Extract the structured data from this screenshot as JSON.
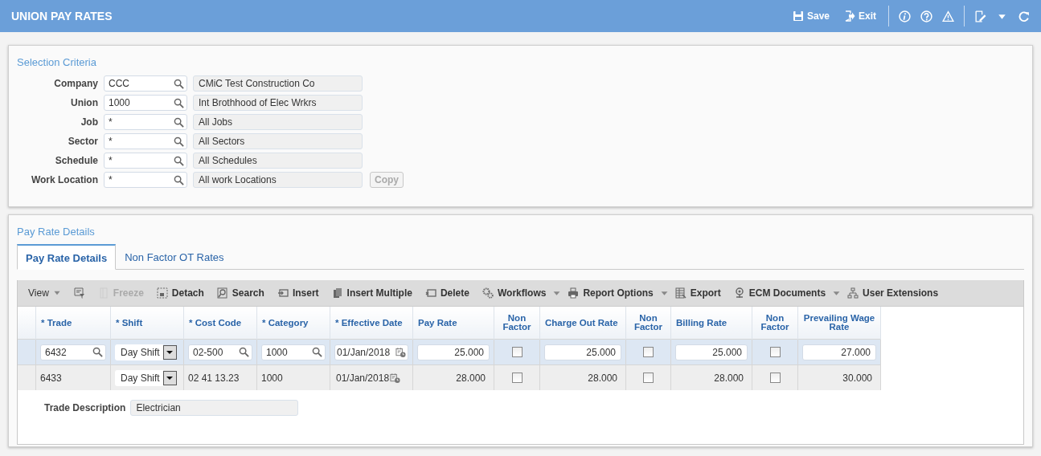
{
  "header": {
    "title": "UNION PAY RATES",
    "actions": [
      {
        "label": "Save"
      },
      {
        "label": "Exit"
      }
    ]
  },
  "selection": {
    "title": "Selection Criteria",
    "fields": [
      {
        "label": "Company",
        "value": "CCC",
        "description": "CMiC Test Construction Co"
      },
      {
        "label": "Union",
        "value": "1000",
        "description": "Int Brothhood of Elec Wrkrs"
      },
      {
        "label": "Job",
        "value": "*",
        "description": "All Jobs"
      },
      {
        "label": "Sector",
        "value": "*",
        "description": "All Sectors"
      },
      {
        "label": "Schedule",
        "value": "*",
        "description": "All Schedules"
      },
      {
        "label": "Work Location",
        "value": "*",
        "description": "All work Locations"
      }
    ],
    "copy_button": {
      "label": "Copy",
      "disabled": true
    }
  },
  "details": {
    "title": "Pay Rate Details",
    "tabs": [
      {
        "label": "Pay Rate Details",
        "selected": true
      },
      {
        "label": "Non Factor OT Rates",
        "selected": false
      }
    ],
    "toolbar": [
      {
        "label": "View",
        "disabled": false,
        "dropdown": true
      },
      {
        "disabled": false,
        "dropdown": false
      },
      {
        "label": "Freeze",
        "disabled": true,
        "dropdown": false
      },
      {
        "label": "Detach",
        "disabled": false,
        "dropdown": false
      },
      {
        "label": "Search",
        "disabled": false,
        "dropdown": false
      },
      {
        "label": "Insert",
        "disabled": false,
        "dropdown": false
      },
      {
        "label": "Insert Multiple",
        "disabled": false,
        "dropdown": false
      },
      {
        "label": "Delete",
        "disabled": false,
        "dropdown": false
      },
      {
        "label": "Workflows",
        "disabled": false,
        "dropdown": true
      },
      {
        "label": "Report Options",
        "disabled": false,
        "dropdown": true
      },
      {
        "label": "Export",
        "disabled": false,
        "dropdown": false
      },
      {
        "label": "ECM Documents",
        "disabled": false,
        "dropdown": true
      },
      {
        "label": "User Extensions",
        "disabled": false,
        "dropdown": false
      }
    ],
    "columns": [
      "* Trade",
      "* Shift",
      "* Cost Code",
      "* Category",
      "* Effective Date",
      "Pay Rate",
      "Non Factor",
      "Charge Out Rate",
      "Non Factor",
      "Billing Rate",
      "Non Factor",
      "Prevailing Wage Rate"
    ],
    "rows": [
      {
        "selected": true,
        "trade": "6432",
        "shift": "Day Shift",
        "cost_code": "02-500",
        "category": "1000",
        "effective_date": "01/Jan/2018",
        "pay_rate": "25.000",
        "pay_non_factor": false,
        "charge_out_rate": "25.000",
        "charge_non_factor": false,
        "billing_rate": "25.000",
        "billing_non_factor": false,
        "prevailing_wage_rate": "27.000"
      },
      {
        "selected": false,
        "trade": "6433",
        "shift": "Day Shift",
        "cost_code": "02 41 13.23",
        "category": "1000",
        "effective_date": "01/Jan/2018",
        "pay_rate": "28.000",
        "pay_non_factor": false,
        "charge_out_rate": "28.000",
        "charge_non_factor": false,
        "billing_rate": "28.000",
        "billing_non_factor": false,
        "prevailing_wage_rate": "30.000"
      }
    ],
    "trade_description": {
      "label": "Trade Description",
      "value": "Electrician"
    }
  }
}
